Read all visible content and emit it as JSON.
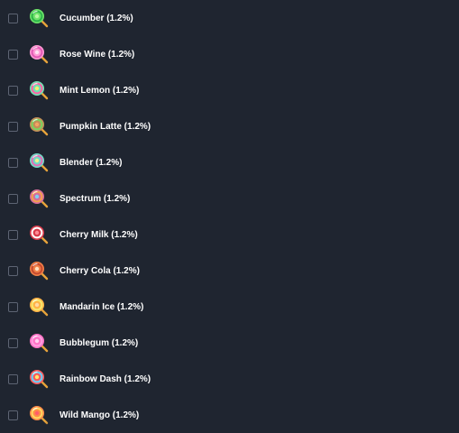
{
  "items": [
    {
      "label": "Cucumber (1.2%)",
      "icon": "cucumber-lollipop-icon",
      "colors": {
        "a": "#6ee36a",
        "b": "#2fb54a",
        "c": "#b8f7a4"
      }
    },
    {
      "label": "Rose Wine (1.2%)",
      "icon": "rose-wine-lollipop-icon",
      "colors": {
        "a": "#ff9ad5",
        "b": "#e35bb6",
        "c": "#ffe0f2"
      }
    },
    {
      "label": "Mint Lemon (1.2%)",
      "icon": "mint-lemon-lollipop-icon",
      "colors": {
        "a": "#71e2b2",
        "b": "#ff62a6",
        "c": "#f7ef72"
      }
    },
    {
      "label": "Pumpkin Latte (1.2%)",
      "icon": "pumpkin-latte-lollipop-icon",
      "colors": {
        "a": "#c48e58",
        "b": "#7ad35f",
        "c": "#f4a463"
      }
    },
    {
      "label": "Blender (1.2%)",
      "icon": "blender-lollipop-icon",
      "colors": {
        "a": "#72d9c6",
        "b": "#e56cb6",
        "c": "#f0f08f"
      }
    },
    {
      "label": "Spectrum (1.2%)",
      "icon": "spectrum-lollipop-icon",
      "colors": {
        "a": "#d56d9c",
        "b": "#f3a24d",
        "c": "#7fd0f2"
      }
    },
    {
      "label": "Cherry Milk (1.2%)",
      "icon": "cherry-milk-lollipop-icon",
      "colors": {
        "a": "#d93a4a",
        "b": "#ffffff",
        "c": "#ff8c96"
      }
    },
    {
      "label": "Cherry Cola (1.2%)",
      "icon": "cherry-cola-lollipop-icon",
      "colors": {
        "a": "#ef7f47",
        "b": "#c54a2f",
        "c": "#ffe0bf"
      }
    },
    {
      "label": "Mandarin Ice (1.2%)",
      "icon": "mandarin-ice-lollipop-icon",
      "colors": {
        "a": "#ffb347",
        "b": "#f6e96d",
        "c": "#ffd9a1"
      }
    },
    {
      "label": "Bubblegum (1.2%)",
      "icon": "bubblegum-lollipop-icon",
      "colors": {
        "a": "#ff74c6",
        "b": "#ff9fe0",
        "c": "#ffd0ef"
      }
    },
    {
      "label": "Rainbow Dash (1.2%)",
      "icon": "rainbow-dash-lollipop-icon",
      "colors": {
        "a": "#ff5a5a",
        "b": "#67d1ff",
        "c": "#ffe56e"
      }
    },
    {
      "label": "Wild Mango (1.2%)",
      "icon": "wild-mango-lollipop-icon",
      "colors": {
        "a": "#ff8c4a",
        "b": "#ffd85f",
        "c": "#ff5d6a"
      }
    }
  ],
  "palette": {
    "background": "#1f2530",
    "checkbox_border": "#5d6473",
    "text": "#ffffff",
    "stick": "#e7a33a"
  }
}
